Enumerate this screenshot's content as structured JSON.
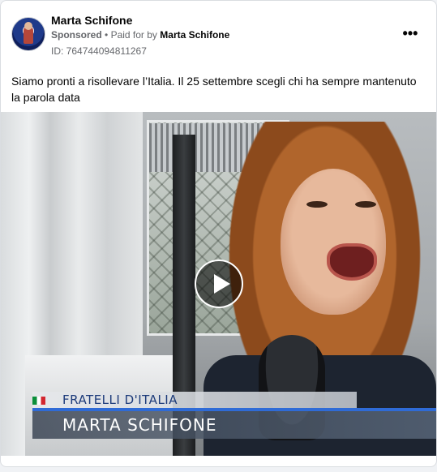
{
  "ad": {
    "page_name": "Marta Schifone",
    "sponsored_label": "Sponsored",
    "separator": "•",
    "paid_for_prefix": "Paid for by",
    "paid_for_name": "Marta Schifone",
    "ad_id": "ID: 764744094811267",
    "more_label": "•••",
    "post_text": "Siamo pronti a risollevare l’Italia. Il 25 settembre scegli chi ha sempre mantenuto la parola data"
  },
  "video": {
    "caption_party": "FRATELLI D'ITALIA",
    "caption_name": "MARTA SCHIFONE",
    "play_icon": "play-icon"
  }
}
